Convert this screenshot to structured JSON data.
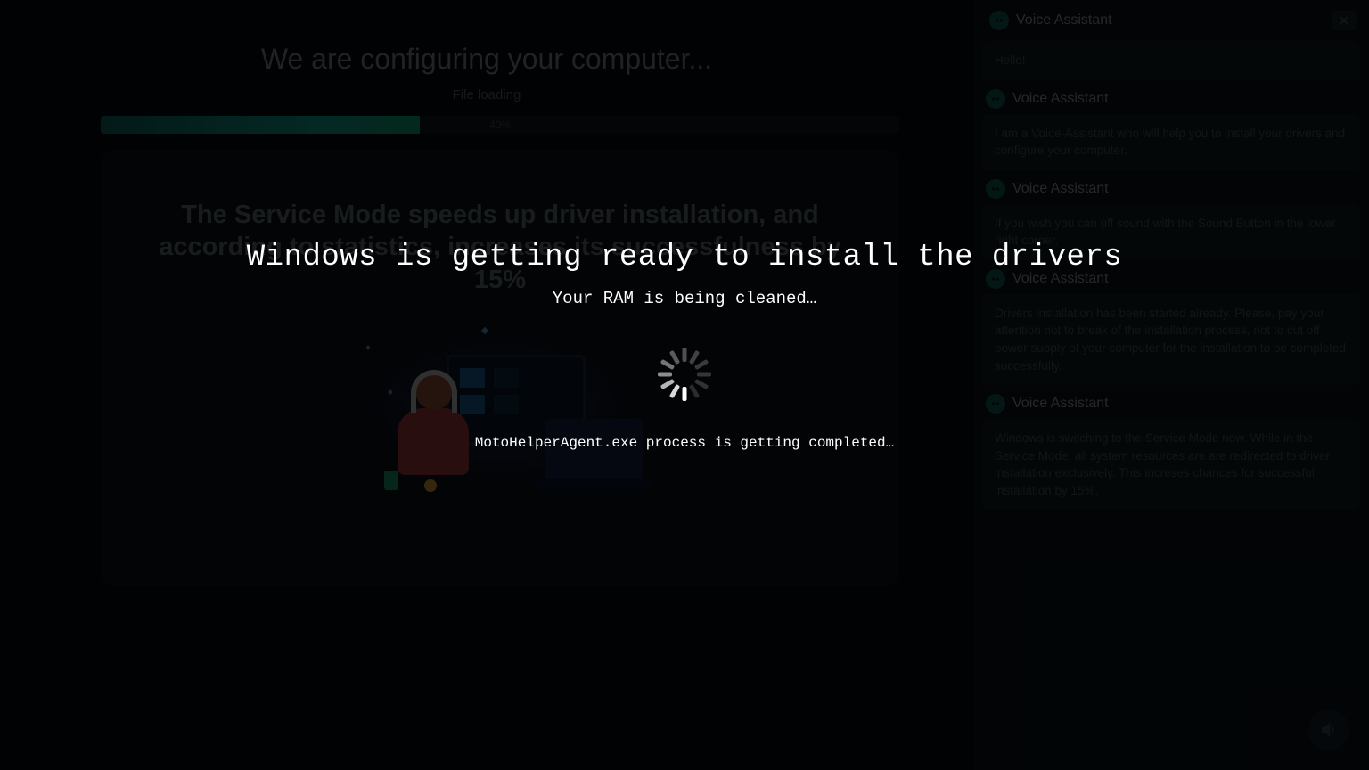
{
  "main": {
    "title": "We are configuring your computer...",
    "status": "File loading",
    "progress_pct": "40%",
    "progress_width": "40%",
    "panel_text": "The Service Mode speeds up driver installation, and according to statistics, increases its successfulness by 15%"
  },
  "sidebar": {
    "assistant_name": "Voice Assistant",
    "messages": [
      {
        "text": "Hello!"
      },
      {
        "text": "I am a Voice-Assistant who will help you to install your drivers and configure your computer."
      },
      {
        "text": "If you wish you can off sound with the Sound Button in the lower right corner."
      },
      {
        "text": "Drivers installation has been started already. Please, pay your attention not to break of the installation process, not to cut off power supply of your computer for the installation to be completed successfully."
      },
      {
        "text": "Windows is switching to the Service Mode now. While in the Service Mode, all system resources are are redirected to driver installation exclusively. This increses chances for successful installation by 15%."
      }
    ]
  },
  "overlay": {
    "title": "Windows is getting ready to install the drivers",
    "sub": "Your RAM is being cleaned…",
    "foot": "MotoHelperAgent.exe process is getting completed…"
  }
}
